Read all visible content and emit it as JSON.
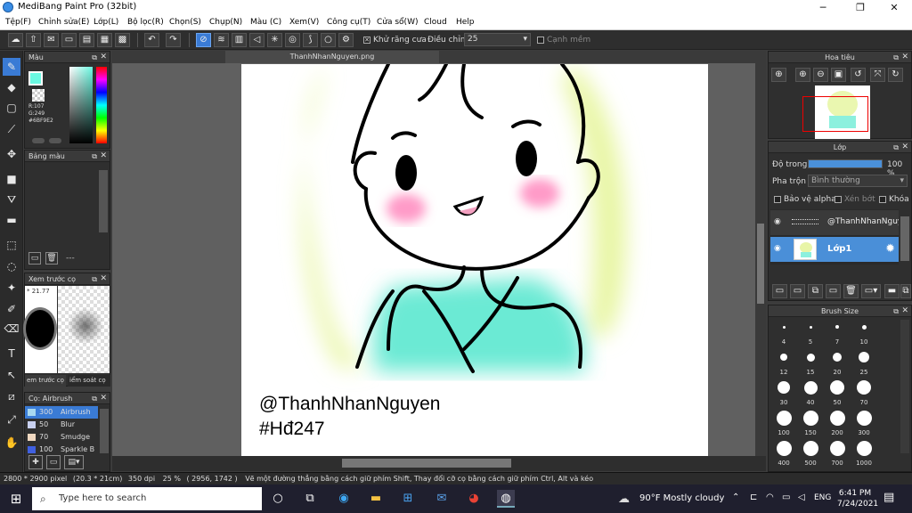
{
  "window": {
    "title": "MediBang Paint Pro (32bit)",
    "minimize": "─",
    "maximize": "❐",
    "close": "✕"
  },
  "menu": [
    "Tệp(F)",
    "Chỉnh sửa(E)",
    "Lớp(L)",
    "Bộ lọc(R)",
    "Chọn(S)",
    "Chụp(N)",
    "Màu (C)",
    "Xem(V)",
    "Công cụ(T)",
    "Cửa sổ(W)",
    "Cloud",
    "Help"
  ],
  "toolbar": {
    "antialias_label": "Khử răng cưa",
    "adjust_label": "Điều chỉnh",
    "adjust_value": "25",
    "edge_label": "Cạnh mềm"
  },
  "color_panel": {
    "title": "Màu",
    "r": "R:107",
    "g": "G:249",
    "hex": "#6BF9E2",
    "color": "#6BF9E2"
  },
  "palette_panel": {
    "title": "Bảng màu",
    "extra": "---"
  },
  "preview_panel": {
    "title": "Xem trước cọ",
    "size": "* 21.77",
    "tab1": "em trước cọ",
    "tab2": "iểm soát cọ"
  },
  "brush_panel": {
    "title": "Cọ: Airbrush",
    "items": [
      {
        "size": "300",
        "name": "Airbrush",
        "color": "#a8d8f0"
      },
      {
        "size": "50",
        "name": "Blur",
        "color": "#c8d0f0"
      },
      {
        "size": "70",
        "name": "Smudge",
        "color": "#f0d8c0"
      },
      {
        "size": "100",
        "name": "Sparkle B",
        "color": "#4060e0"
      }
    ]
  },
  "document": {
    "tab": "ThanhNhanNguyen.png",
    "line1": "@ThanhNhanNguyen",
    "line2": "#Hđ247"
  },
  "navigator": {
    "title": "Hoa tiêu"
  },
  "layer_panel": {
    "title": "Lớp",
    "opacity_label": "Độ trong",
    "opacity_value": "100 %",
    "opacity_fraction": 1.0,
    "blend_label": "Pha trộn",
    "blend_value": "Bình thường",
    "protect_alpha": "Bảo vệ alpha",
    "clipping": "Xén bớt",
    "lock": "Khóa",
    "layers": [
      {
        "name": "@ThanhNhanNguy",
        "selected": false
      },
      {
        "name": "Lớp1",
        "selected": true
      }
    ]
  },
  "brush_size_panel": {
    "title": "Brush Size",
    "sizes": [
      "4",
      "5",
      "7",
      "10",
      "12",
      "15",
      "20",
      "25",
      "30",
      "40",
      "50",
      "70",
      "100",
      "150",
      "200",
      "300",
      "400",
      "500",
      "700",
      "1000"
    ]
  },
  "statusbar": {
    "size": "2800 * 2900 pixel",
    "cm": "(20.3 * 21cm)",
    "dpi": "350 dpi",
    "zoom": "25 %",
    "coords": "( 2956, 1742 )",
    "hint": "Vẽ một đường thẳng bằng cách giữ phím Shift, Thay đổi cỡ cọ bằng cách giữ phím Ctrl, Alt và kéo"
  },
  "taskbar": {
    "search_placeholder": "Type here to search",
    "weather": "90°F  Mostly cloudy",
    "lang": "ENG",
    "time": "6:41 PM",
    "date": "7/24/2021"
  }
}
